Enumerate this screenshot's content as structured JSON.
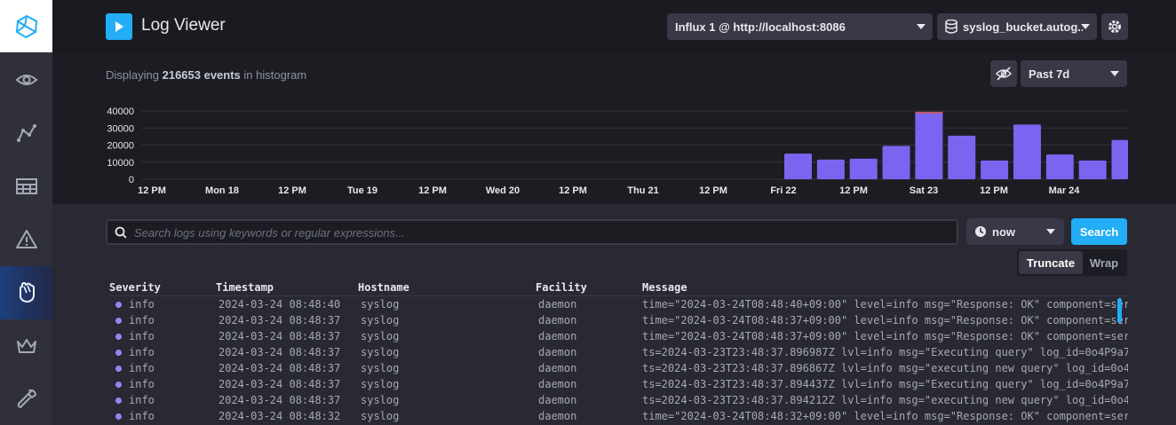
{
  "header": {
    "title": "Log Viewer",
    "source_dropdown": "Influx 1 @ http://localhost:8086",
    "bucket_dropdown": "syslog_bucket.autog...",
    "play_icon": "play-icon",
    "settings_icon": "gear-icon"
  },
  "sidebar": {
    "items": [
      {
        "name": "logo",
        "icon": "influx-logo-icon"
      },
      {
        "name": "status",
        "icon": "eye-icon"
      },
      {
        "name": "explore",
        "icon": "graph-icon"
      },
      {
        "name": "dashboards",
        "icon": "dashboard-grid-icon"
      },
      {
        "name": "alerts",
        "icon": "alert-icon"
      },
      {
        "name": "logs",
        "icon": "hand-icon",
        "active": true
      },
      {
        "name": "admin",
        "icon": "crown-icon"
      },
      {
        "name": "configuration",
        "icon": "wrench-icon"
      }
    ]
  },
  "histogram": {
    "info_prefix": "Displaying",
    "info_count": "216653 events",
    "info_suffix": "in histogram",
    "range": "Past 7d",
    "visibility_icon": "eye-off-icon"
  },
  "chart_data": {
    "type": "bar",
    "title": "",
    "xlabel": "",
    "ylabel": "",
    "ylim": [
      0,
      45000
    ],
    "yticks": [
      0,
      10000,
      20000,
      30000,
      40000
    ],
    "ytick_labels": [
      "0",
      "10000",
      "20000",
      "30000",
      "40000"
    ],
    "xtick_labels": [
      "12 PM",
      "Mon 18",
      "12 PM",
      "Tue 19",
      "12 PM",
      "Wed 20",
      "12 PM",
      "Thu 21",
      "12 PM",
      "Fri 22",
      "12 PM",
      "Sat 23",
      "12 PM",
      "Mar 24"
    ],
    "categories": [
      "Fri 22 00:00",
      "Fri 22 06:00",
      "Fri 22 12:00",
      "Fri 22 18:00",
      "Sat 23 00:00",
      "Sat 23 06:00",
      "Sat 23 12:00",
      "Sat 23 18:00",
      "Mar 24 00:00",
      "Mar 24 06:00",
      "Mar 24 12:00"
    ],
    "values": [
      15000,
      11500,
      12000,
      19500,
      39500,
      25500,
      11000,
      32000,
      14500,
      11000,
      23000
    ],
    "grid": true,
    "colors": {
      "bar": "#7a65f1",
      "bar_top": "#c05a6e",
      "grid": "#34343f",
      "axis_text": "#e7e8eb"
    }
  },
  "search": {
    "placeholder": "Search logs using keywords or regular expressions...",
    "value": "",
    "time": "now",
    "button": "Search"
  },
  "view_toggle": {
    "truncate": "Truncate",
    "wrap": "Wrap",
    "selected": "Truncate"
  },
  "table": {
    "columns": [
      "Severity",
      "Timestamp",
      "Hostname",
      "Facility",
      "Message"
    ],
    "rows": [
      {
        "severity": "info",
        "timestamp": "2024-03-24 08:48:40",
        "hostname": "syslog",
        "facility": "daemon",
        "message": "time=\"2024-03-24T08:48:40+09:00\" level=info msg=\"Response: OK\" component=ser"
      },
      {
        "severity": "info",
        "timestamp": "2024-03-24 08:48:37",
        "hostname": "syslog",
        "facility": "daemon",
        "message": "time=\"2024-03-24T08:48:37+09:00\" level=info msg=\"Response: OK\" component=ser"
      },
      {
        "severity": "info",
        "timestamp": "2024-03-24 08:48:37",
        "hostname": "syslog",
        "facility": "daemon",
        "message": "time=\"2024-03-24T08:48:37+09:00\" level=info msg=\"Response: OK\" component=ser"
      },
      {
        "severity": "info",
        "timestamp": "2024-03-24 08:48:37",
        "hostname": "syslog",
        "facility": "daemon",
        "message": "ts=2024-03-23T23:48:37.896987Z lvl=info msg=\"Executing query\" log_id=0o4P9a7"
      },
      {
        "severity": "info",
        "timestamp": "2024-03-24 08:48:37",
        "hostname": "syslog",
        "facility": "daemon",
        "message": "ts=2024-03-23T23:48:37.896867Z lvl=info msg=\"executing new query\" log_id=0o4"
      },
      {
        "severity": "info",
        "timestamp": "2024-03-24 08:48:37",
        "hostname": "syslog",
        "facility": "daemon",
        "message": "ts=2024-03-23T23:48:37.894437Z lvl=info msg=\"Executing query\" log_id=0o4P9a7"
      },
      {
        "severity": "info",
        "timestamp": "2024-03-24 08:48:37",
        "hostname": "syslog",
        "facility": "daemon",
        "message": "ts=2024-03-23T23:48:37.894212Z lvl=info msg=\"executing new query\" log_id=0o4"
      },
      {
        "severity": "info",
        "timestamp": "2024-03-24 08:48:32",
        "hostname": "syslog",
        "facility": "daemon",
        "message": "time=\"2024-03-24T08:48:32+09:00\" level=info msg=\"Response: OK\" component=ser"
      }
    ],
    "severity_color": "#9a82f4"
  },
  "colors": {
    "accent": "#22adf6",
    "background": "#292933",
    "panel": "#1c1c23"
  }
}
